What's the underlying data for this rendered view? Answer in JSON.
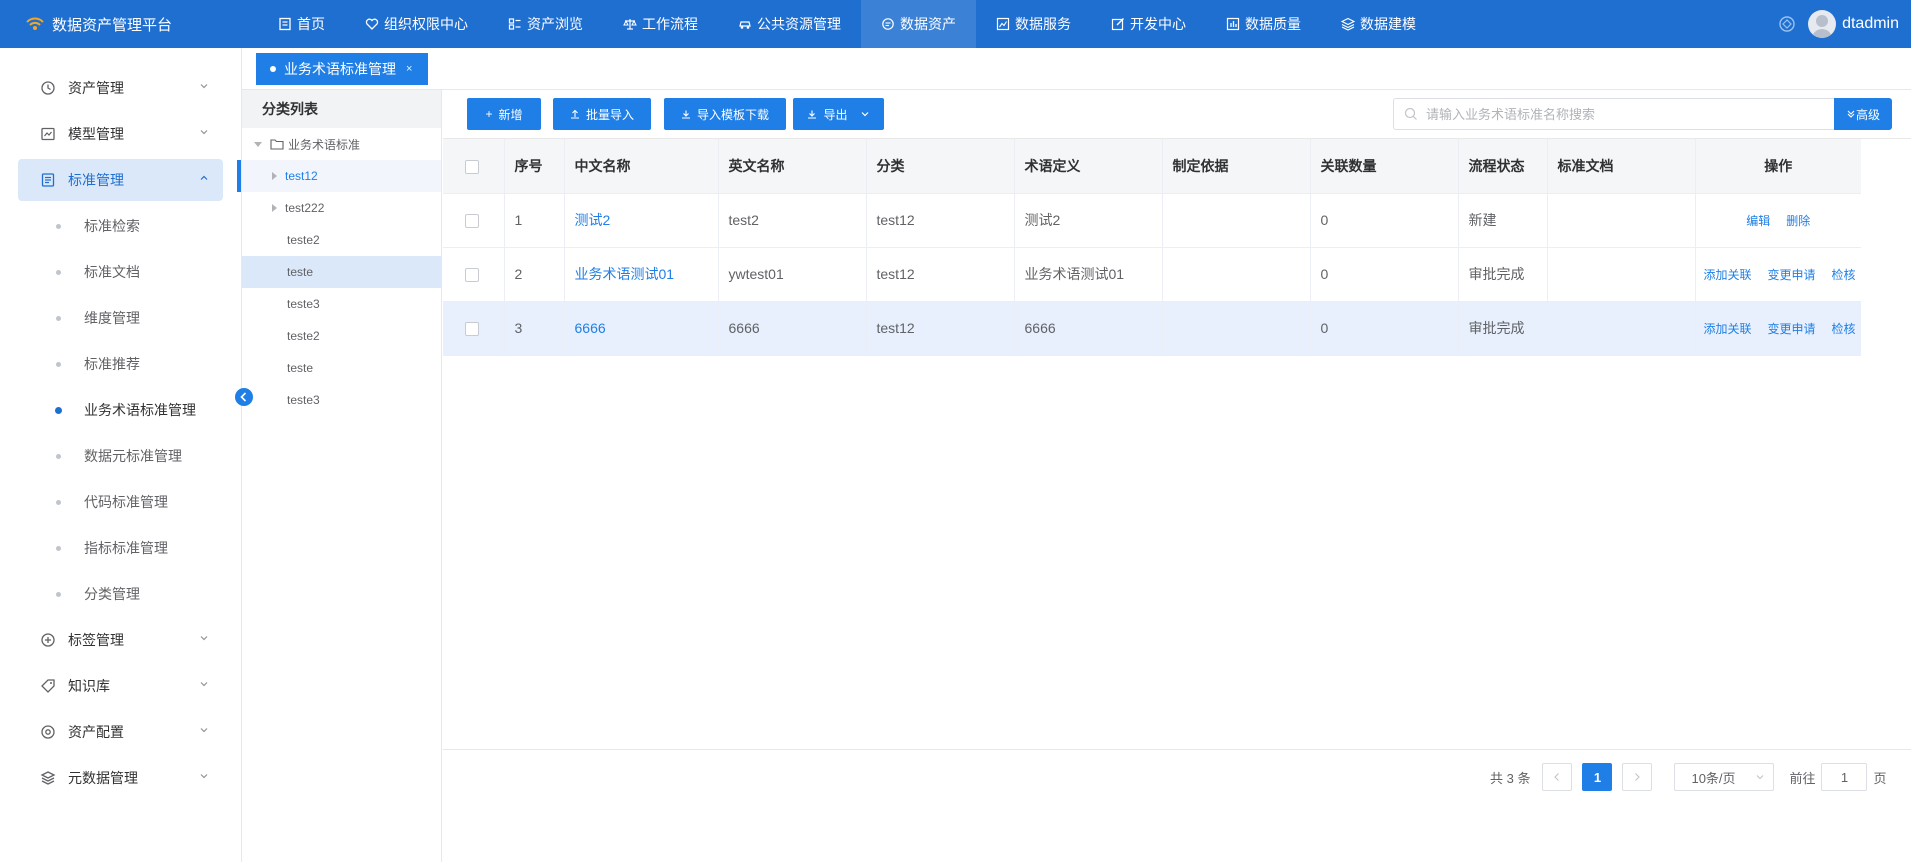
{
  "app": {
    "title": "数据资产管理平台"
  },
  "nav": [
    {
      "label": "首页",
      "icon": "home-doc-icon"
    },
    {
      "label": "组织权限中心",
      "icon": "shield-heart-icon"
    },
    {
      "label": "资产浏览",
      "icon": "grid-list-icon"
    },
    {
      "label": "工作流程",
      "icon": "scale-icon"
    },
    {
      "label": "公共资源管理",
      "icon": "car-icon"
    },
    {
      "label": "数据资产",
      "icon": "chat-icon",
      "active": true
    },
    {
      "label": "数据服务",
      "icon": "chart-icon"
    },
    {
      "label": "开发中心",
      "icon": "edit-icon"
    },
    {
      "label": "数据质量",
      "icon": "bar-chart-icon"
    },
    {
      "label": "数据建模",
      "icon": "layers-icon"
    }
  ],
  "user": {
    "name": "dtadmin"
  },
  "sidebar": {
    "menus": [
      {
        "label": "资产管理",
        "icon": "clock-icon"
      },
      {
        "label": "模型管理",
        "icon": "chart-box-icon"
      },
      {
        "label": "标准管理",
        "icon": "doc-icon",
        "active": true
      }
    ],
    "submenu": [
      {
        "label": "标准检索"
      },
      {
        "label": "标准文档"
      },
      {
        "label": "维度管理"
      },
      {
        "label": "标准推荐"
      },
      {
        "label": "业务术语标准管理",
        "active": true
      },
      {
        "label": "数据元标准管理"
      },
      {
        "label": "代码标准管理"
      },
      {
        "label": "指标标准管理"
      },
      {
        "label": "分类管理"
      }
    ],
    "menus_after": [
      {
        "label": "标签管理",
        "icon": "plus-circle-icon"
      },
      {
        "label": "知识库",
        "icon": "tag-icon"
      },
      {
        "label": "资产配置",
        "icon": "target-icon"
      },
      {
        "label": "元数据管理",
        "icon": "stack-icon"
      }
    ]
  },
  "tab": {
    "label": "业务术语标准管理",
    "close": "×"
  },
  "category": {
    "title": "分类列表",
    "root": "业务术语标准",
    "items": [
      "test12",
      "test222",
      "teste2",
      "teste",
      "teste3",
      "teste2",
      "teste",
      "teste3"
    ]
  },
  "toolbar": {
    "add": "新增",
    "batch_import": "批量导入",
    "template_download": "导入模板下载",
    "export": "导出",
    "search_placeholder": "请输入业务术语标准名称搜索",
    "advanced": "高级"
  },
  "table": {
    "headers": [
      "序号",
      "中文名称",
      "英文名称",
      "分类",
      "术语定义",
      "制定依据",
      "关联数量",
      "流程状态",
      "标准文档",
      "操作"
    ],
    "rows": [
      {
        "no": "1",
        "cn": "测试2",
        "en": "test2",
        "cat": "test12",
        "def": "测试2",
        "basis": "",
        "count": "0",
        "status": "新建",
        "doc": "",
        "ops": [
          "编辑",
          "删除"
        ]
      },
      {
        "no": "2",
        "cn": "业务术语测试01",
        "en": "ywtest01",
        "cat": "test12",
        "def": "业务术语测试01",
        "basis": "",
        "count": "0",
        "status": "审批完成",
        "doc": "",
        "ops": [
          "添加关联",
          "变更申请",
          "检核"
        ]
      },
      {
        "no": "3",
        "cn": "6666",
        "en": "6666",
        "cat": "test12",
        "def": "6666",
        "basis": "",
        "count": "0",
        "status": "审批完成",
        "doc": "",
        "ops": [
          "添加关联",
          "变更申请",
          "检核"
        ]
      }
    ]
  },
  "pager": {
    "total": "共 3 条",
    "page": "1",
    "size": "10条/页",
    "goto": "前往",
    "goto_value": "1",
    "unit": "页"
  },
  "colors": {
    "primary": "#1f7fe6",
    "topbar": "#1f6fd1",
    "active_bg": "#dbe8f9"
  }
}
